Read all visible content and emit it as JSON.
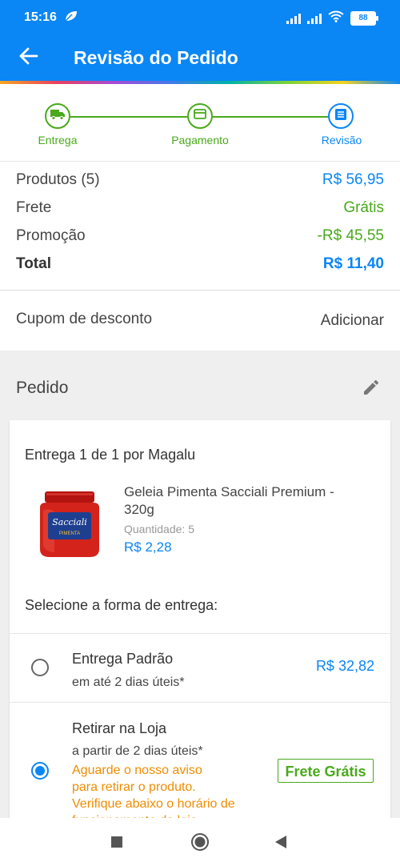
{
  "status_bar": {
    "time": "15:16",
    "battery": "88"
  },
  "header": {
    "title": "Revisão do Pedido"
  },
  "stepper": {
    "steps": [
      {
        "label": "Entrega",
        "icon": "truck-icon",
        "state": "done"
      },
      {
        "label": "Pagamento",
        "icon": "card-icon",
        "state": "done"
      },
      {
        "label": "Revisão",
        "icon": "list-icon",
        "state": "active"
      }
    ]
  },
  "summary": {
    "products_label": "Produtos (5)",
    "products_value": "R$ 56,95",
    "shipping_label": "Frete",
    "shipping_value": "Grátis",
    "promo_label": "Promoção",
    "promo_value": "-R$ 45,55",
    "total_label": "Total",
    "total_value": "R$ 11,40"
  },
  "coupon": {
    "label": "Cupom de desconto",
    "action": "Adicionar"
  },
  "order": {
    "title": "Pedido",
    "delivery_title": "Entrega 1 de 1 por Magalu",
    "product": {
      "name": "Geleia Pimenta Sacciali Premium - 320g",
      "quantity_label": "Quantidade:",
      "quantity_value": "5",
      "price": "R$ 2,28",
      "jar_brand": "Sacciali",
      "jar_flavor": "PIMENTA"
    },
    "shipping_select_title": "Selecione a forma de entrega:",
    "options": [
      {
        "title": "Entrega Padrão",
        "subtitle": "em até 2 dias úteis*",
        "price": "R$ 32,82",
        "selected": false
      },
      {
        "title": "Retirar na Loja",
        "subtitle": "a partir de 2 dias úteis*",
        "warning_1": "Aguarde o nosso aviso",
        "warning_2": "para retirar o produto.",
        "warning_3": "Verifique abaixo o horário de",
        "warning_4": "funcionamento da loja.",
        "badge": "Frete Grátis",
        "selected": true
      }
    ]
  },
  "colors": {
    "primary": "#0a86f5",
    "success": "#4aa91c",
    "warning": "#f08c00"
  }
}
